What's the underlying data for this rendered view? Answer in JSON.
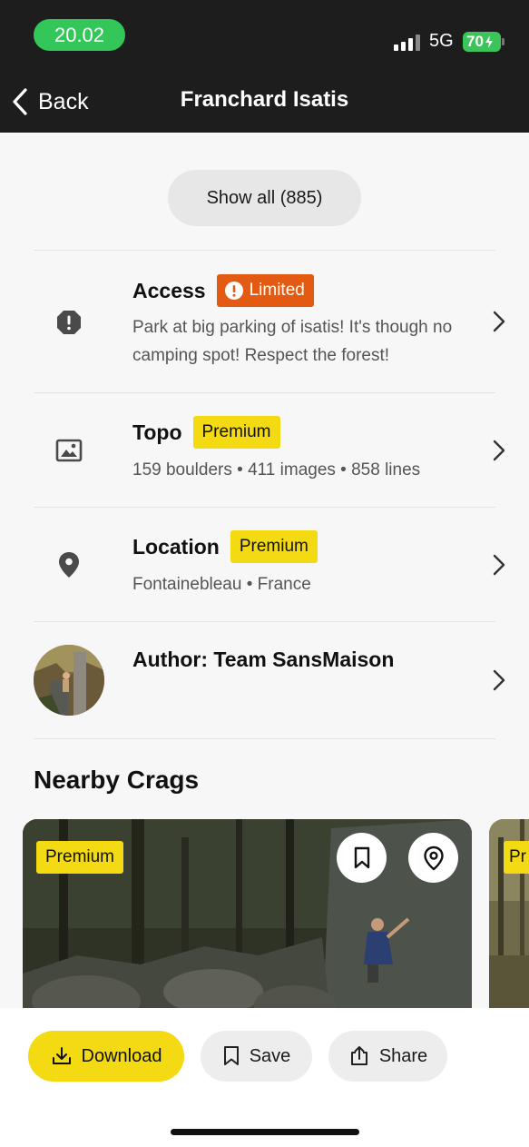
{
  "status_bar": {
    "time": "20.02",
    "network": "5G",
    "battery": "70"
  },
  "nav": {
    "back_label": "Back",
    "title": "Franchard Isatis"
  },
  "show_all_label": "Show all (885)",
  "rows": {
    "access": {
      "title": "Access",
      "badge": "Limited",
      "description": "Park at big parking of isatis! It's though no camping spot! Respect the forest!"
    },
    "topo": {
      "title": "Topo",
      "badge": "Premium",
      "description": "159 boulders • 411 images • 858 lines"
    },
    "location": {
      "title": "Location",
      "badge": "Premium",
      "description": "Fontainebleau • France"
    },
    "author": {
      "title": "Author: Team SansMaison"
    }
  },
  "nearby": {
    "title": "Nearby Crags",
    "cards": [
      {
        "badge": "Premium"
      },
      {
        "badge": "Pr"
      }
    ]
  },
  "actions": {
    "download": "Download",
    "save": "Save",
    "share": "Share"
  },
  "colors": {
    "accent_yellow": "#f3da12",
    "limited_orange": "#e35b12",
    "status_green": "#33c659",
    "dark_bar": "#1d1d1d"
  },
  "icons": [
    "back-chevron-icon",
    "alert-octagon-icon",
    "image-icon",
    "map-pin-icon",
    "chevron-right-icon",
    "bookmark-icon",
    "map-pin-outline-icon",
    "download-icon",
    "share-icon"
  ]
}
